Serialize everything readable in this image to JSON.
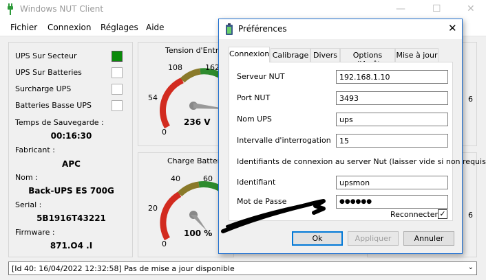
{
  "app": {
    "title": "Windows NUT Client",
    "win_minimize": "—",
    "win_maximize": "☐",
    "win_close": "✕"
  },
  "menu": [
    {
      "label": "Fichier"
    },
    {
      "label": "Connexion"
    },
    {
      "label": "Réglages"
    },
    {
      "label": "Aide"
    }
  ],
  "left_panel": {
    "indicators": [
      {
        "label": "UPS Sur Secteur",
        "on": true
      },
      {
        "label": "UPS Sur Batteries",
        "on": false
      },
      {
        "label": "Surcharge UPS",
        "on": false
      },
      {
        "label": "Batteries Basse UPS",
        "on": false
      }
    ],
    "backup_time": {
      "label": "Temps de Sauvegarde :",
      "value": "00:16:30"
    },
    "manufacturer": {
      "label": "Fabricant :",
      "value": "APC"
    },
    "name": {
      "label": "Nom :",
      "value": "Back-UPS ES 700G"
    },
    "serial": {
      "label": "Serial :",
      "value": "5B1916T43221"
    },
    "firmware": {
      "label": "Firmware :",
      "value": "871.O4 .I"
    }
  },
  "gauges": {
    "voltage": {
      "title": "Tension d'Entrée",
      "ticks": [
        "0",
        "54",
        "108",
        "162"
      ],
      "value_text": "236 V",
      "colors": {
        "red": "#d22b1f",
        "green": "#2e8b2e"
      }
    },
    "charge": {
      "title": "Charge Batterie",
      "ticks": [
        "0",
        "20",
        "40",
        "60"
      ],
      "value_text": "100 %"
    },
    "right_gauge_edge_1": "6",
    "right_gauge_edge_2": "6"
  },
  "statusbar": {
    "text": "[Id 40: 16/04/2022 12:32:58] Pas de mise a jour disponible",
    "arrow": "⌄"
  },
  "dialog": {
    "title": "Préférences",
    "close": "✕",
    "tabs": [
      {
        "label": "Connexion",
        "active": true
      },
      {
        "label": "Calibrage",
        "active": false
      },
      {
        "label": "Divers",
        "active": false
      },
      {
        "label": "Options d'Arrêt",
        "active": false
      },
      {
        "label": "Mise à jour",
        "active": false
      }
    ],
    "fields": {
      "server": {
        "label": "Serveur NUT",
        "value": "192.168.1.10"
      },
      "port": {
        "label": "Port NUT",
        "value": "3493"
      },
      "ups_name": {
        "label": "Nom UPS",
        "value": "ups"
      },
      "interval": {
        "label": "Intervalle d'interrogation",
        "value": "15"
      },
      "note": "Identifiants de connexion au server Nut (laisser vide si non requis)",
      "login": {
        "label": "Identifiant",
        "value": "upsmon"
      },
      "password": {
        "label": "Mot de Passe",
        "value": "●●●●●●"
      }
    },
    "reconnect": {
      "label": "Reconnecter",
      "checked": true,
      "mark": "✓"
    },
    "buttons": {
      "ok": "Ok",
      "apply": "Appliquer",
      "cancel": "Annuler"
    }
  }
}
